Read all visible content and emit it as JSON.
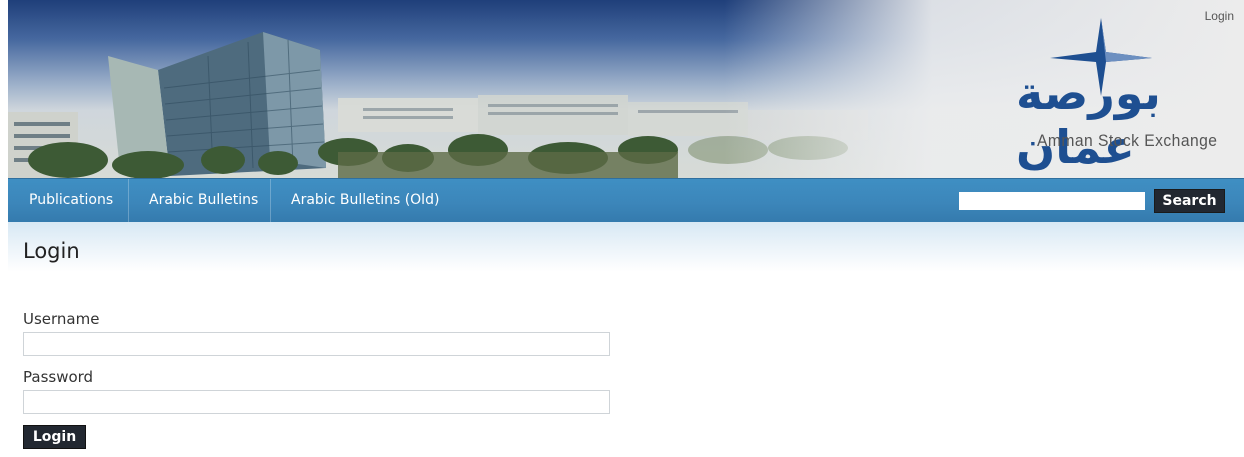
{
  "header": {
    "login_link": "Login",
    "logo": {
      "arabic_text": "بورصة عمان",
      "english_text": "Amman Stock Exchange",
      "brand_color": "#1e4f91",
      "icon": "four-point-star-icon"
    }
  },
  "nav": {
    "items": [
      {
        "label": "Publications"
      },
      {
        "label": "Arabic Bulletins"
      },
      {
        "label": "Arabic Bulletins (Old)"
      }
    ],
    "search": {
      "value": "",
      "button_label": "Search"
    },
    "color": "#3c86ba"
  },
  "main": {
    "title": "Login",
    "form": {
      "username_label": "Username",
      "username_value": "",
      "password_label": "Password",
      "password_value": "",
      "submit_label": "Login"
    }
  },
  "colors": {
    "button_dark": "#222831",
    "title_band": "#d7e8f4"
  }
}
